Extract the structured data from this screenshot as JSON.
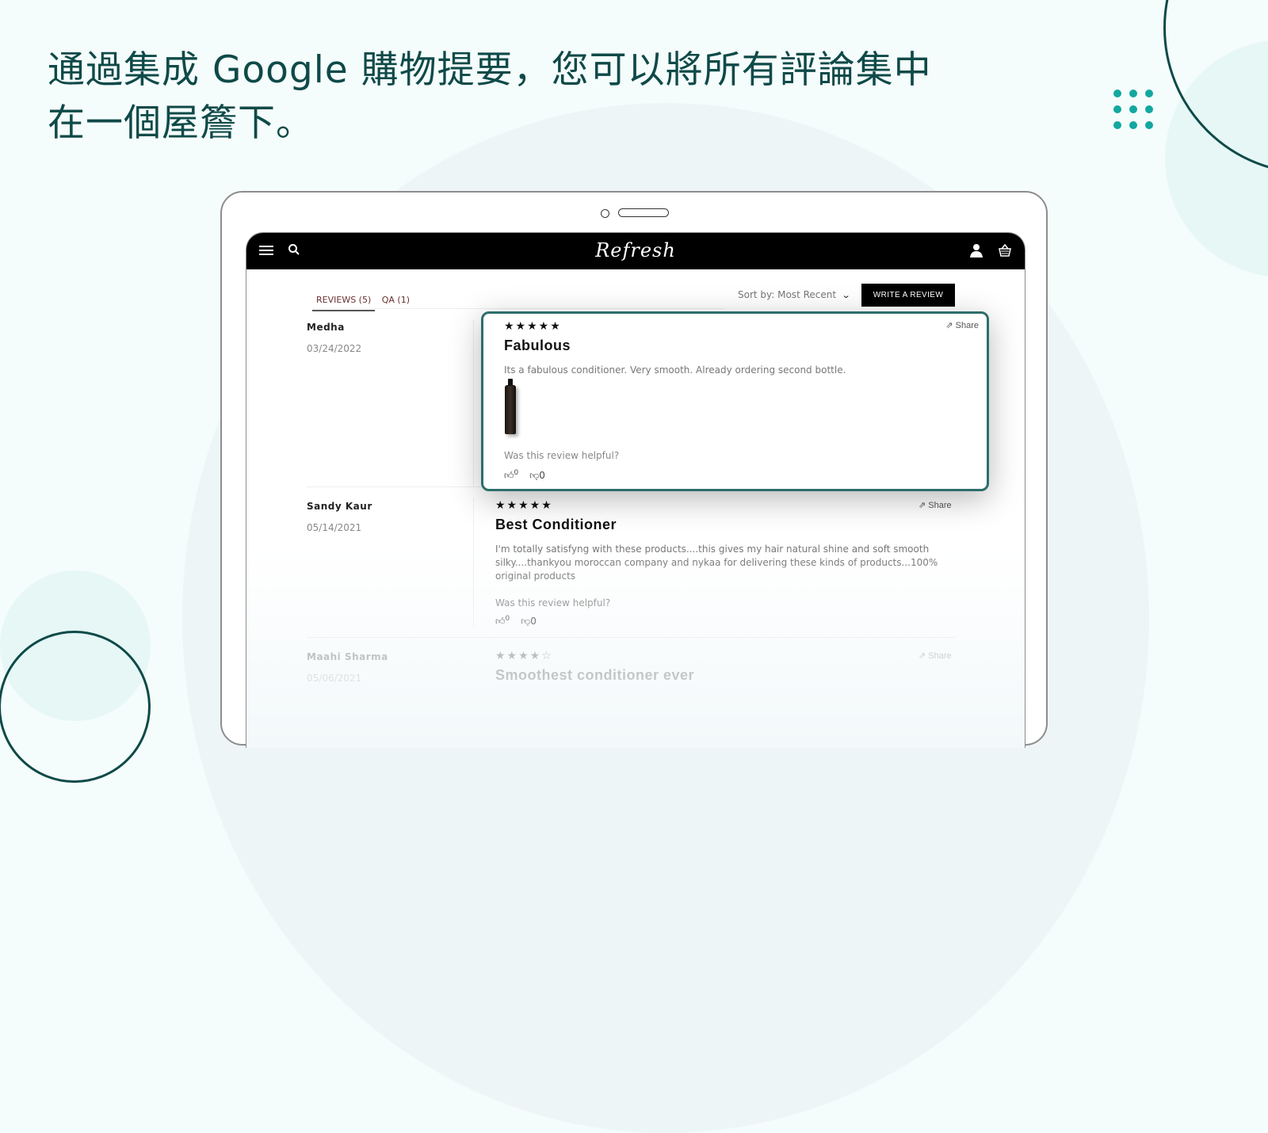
{
  "headline": "通過集成 Google 購物提要，您可以將所有評論集中在一個屋簷下。",
  "colors": {
    "brand_dark": "#0e4a48",
    "accent_teal": "#12a8a0",
    "card_border": "#2d6e6a"
  },
  "store": {
    "logo": "Refresh",
    "icons": {
      "menu": "hamburger-menu-icon",
      "search": "search-icon",
      "account": "user-icon",
      "cart": "basket-icon"
    }
  },
  "reviews_widget": {
    "tabs": [
      {
        "label": "REVIEWS (5)",
        "active": true
      },
      {
        "label": "QA (1)",
        "active": false
      }
    ],
    "sort_label": "Sort by: Most Recent",
    "write_review_label": "WRITE A REVIEW",
    "share_label": "Share",
    "helpful_label": "Was this review helpful?",
    "reviews": [
      {
        "author": "Medha",
        "date": "03/24/2022",
        "stars": "★★★★★",
        "rating": 5,
        "title": "Fabulous",
        "text": "Its a fabulous conditioner. Very smooth. Already ordering second bottle.",
        "has_photo": true,
        "upvotes": "0",
        "downvotes": "0"
      },
      {
        "author": "Sandy Kaur",
        "date": "05/14/2021",
        "stars": "★★★★★",
        "rating": 5,
        "title": "Best Conditioner",
        "text": "I'm totally satisfyng with these products....this gives my hair natural shine and soft smooth silky....thankyou moroccan company and nykaa for delivering these kinds of products...100% original products",
        "upvotes": "0",
        "downvotes": "0"
      },
      {
        "author": "Maahi Sharma",
        "date": "05/06/2021",
        "stars": "★★★★☆",
        "rating": 4,
        "title": "Smoothest conditioner ever"
      }
    ]
  }
}
